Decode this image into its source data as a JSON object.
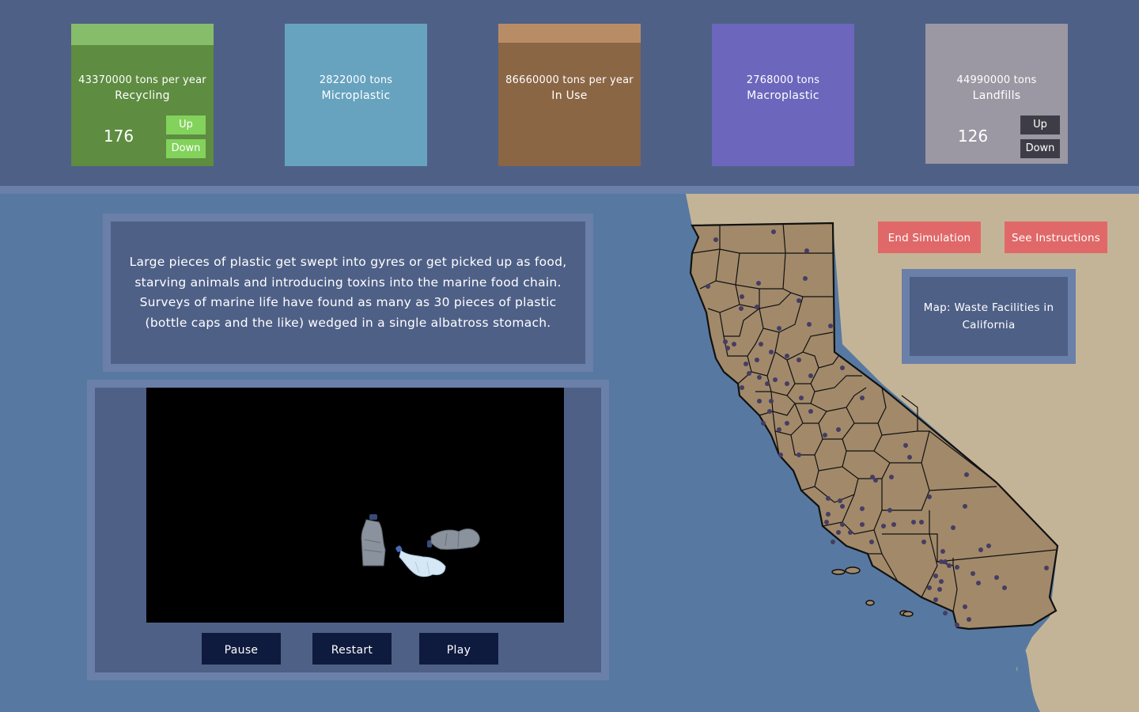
{
  "cards": [
    {
      "line1": "43370000 tons per year",
      "line2": "Recycling",
      "count": "176",
      "up": "Up",
      "down": "Down",
      "color": "#5e8c41",
      "cap_color": "#86bd6a",
      "btn_color": "#82d25b"
    },
    {
      "line1": "2822000 tons",
      "line2": "Microplastic",
      "color": "#67a3bf"
    },
    {
      "line1": "86660000 tons per year",
      "line2": "In Use",
      "color": "#8a6644",
      "cap_color": "#b88d65"
    },
    {
      "line1": "2768000 tons",
      "line2": "Macroplastic",
      "color": "#6c66bd"
    },
    {
      "line1": "44990000 tons",
      "line2": "Landfills",
      "count": "126",
      "up": "Up",
      "down": "Down",
      "color": "#9b98a3",
      "btn_color": "#3e3d47"
    }
  ],
  "buttons": {
    "end": "End Simulation",
    "instructions": "See Instructions"
  },
  "map_label": "Map: Waste Facilities in California",
  "info_text": "Large pieces of plastic get swept into gyres or get picked up as food, starving animals and introducing toxins into the marine food chain. Surveys of marine life have found as many as 30 pieces of plastic (bottle caps and the like) wedged in a single albatross stomach.",
  "video_controls": {
    "pause": "Pause",
    "restart": "Restart",
    "play": "Play"
  },
  "colors": {
    "background": "#5779a1",
    "top_band": "#4f6087",
    "panel": "#4f6087",
    "panel_border": "#6a80a9",
    "land": "#a1896a",
    "neighbor_land": "#c4b497",
    "facility_dot": "#453d63",
    "red_button": "#e06868",
    "control_button": "#0e1b3e"
  }
}
